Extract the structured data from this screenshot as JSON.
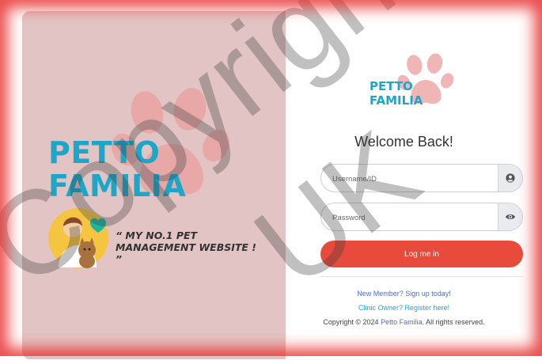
{
  "brand": {
    "name_line1": "PETTO",
    "name_line2": "FAMILIA",
    "tagline_line1": "“ MY NO.1 PET",
    "tagline_line2": "MANAGEMENT WEBSITE ! ”"
  },
  "login": {
    "welcome": "Welcome Back!",
    "username_placeholder": "Username/ID",
    "password_placeholder": "Password",
    "submit_label": "Log me in",
    "signup_link": "New Member? Sign up today!",
    "clinic_link": "Clinic Owner? Register here!",
    "copyright_prefix": "Copyright © 2024 ",
    "copyright_link": "Petto Familia",
    "copyright_suffix": ". All rights reserved."
  },
  "icons": {
    "username_addon": "user-circle-icon",
    "password_addon": "eye-icon",
    "logo": "paw-icon"
  },
  "colors": {
    "brand_teal": "#1da6c7",
    "left_panel_bg": "#e3c4c4",
    "paw": "#f0b6b6",
    "button": "#e84b3c",
    "frame_glow": "#e82d2d"
  },
  "watermark": {
    "text1": "Copyright",
    "text2": "UK"
  }
}
